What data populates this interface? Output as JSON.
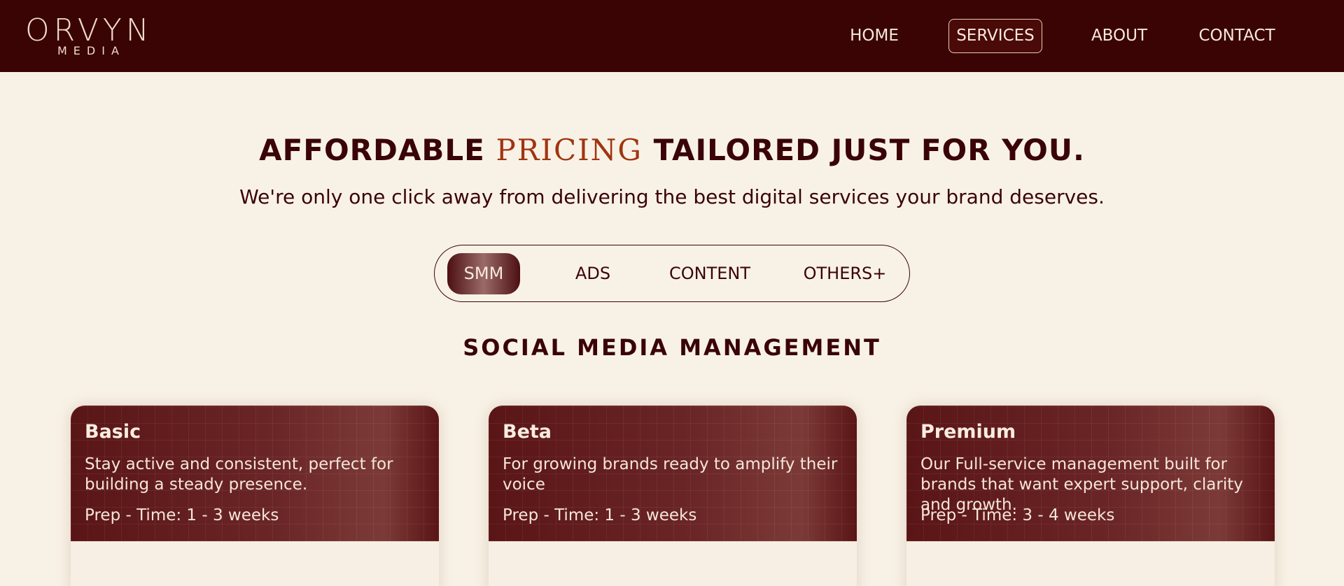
{
  "brand": {
    "logo_main": "ORVYN",
    "logo_sub": "MEDIA"
  },
  "nav": {
    "items": [
      {
        "label": "HOME",
        "active": false
      },
      {
        "label": "SERVICES",
        "active": true
      },
      {
        "label": "ABOUT",
        "active": false
      },
      {
        "label": "CONTACT",
        "active": false
      }
    ]
  },
  "hero": {
    "headline_before": "AFFORDABLE ",
    "headline_accent": "PRICING",
    "headline_after": " TAILORED JUST FOR YOU.",
    "subline": "We're only one click away from delivering the best digital services your brand deserves."
  },
  "tabs": {
    "items": [
      {
        "label": "SMM",
        "active": true
      },
      {
        "label": "ADS",
        "active": false
      },
      {
        "label": "CONTENT",
        "active": false
      },
      {
        "label": "OTHERS+",
        "active": false
      }
    ]
  },
  "section": {
    "title": "SOCIAL MEDIA MANAGEMENT"
  },
  "plans": [
    {
      "name": "Basic",
      "description": "Stay active and consistent, perfect for building a steady presence.",
      "prep": "Prep - Time: 1 - 3 weeks"
    },
    {
      "name": "Beta",
      "description": "For growing brands ready to amplify their voice",
      "prep": "Prep - Time: 1 - 3 weeks"
    },
    {
      "name": "Premium",
      "description": "Our Full-service management built for brands that want expert support, clarity and growth.",
      "prep": "Prep - Time: 3 - 4 weeks"
    }
  ],
  "colors": {
    "header_bg": "#3a0304",
    "page_bg": "#f8f2e6",
    "text_dark": "#3a0406",
    "accent": "#a13411"
  }
}
